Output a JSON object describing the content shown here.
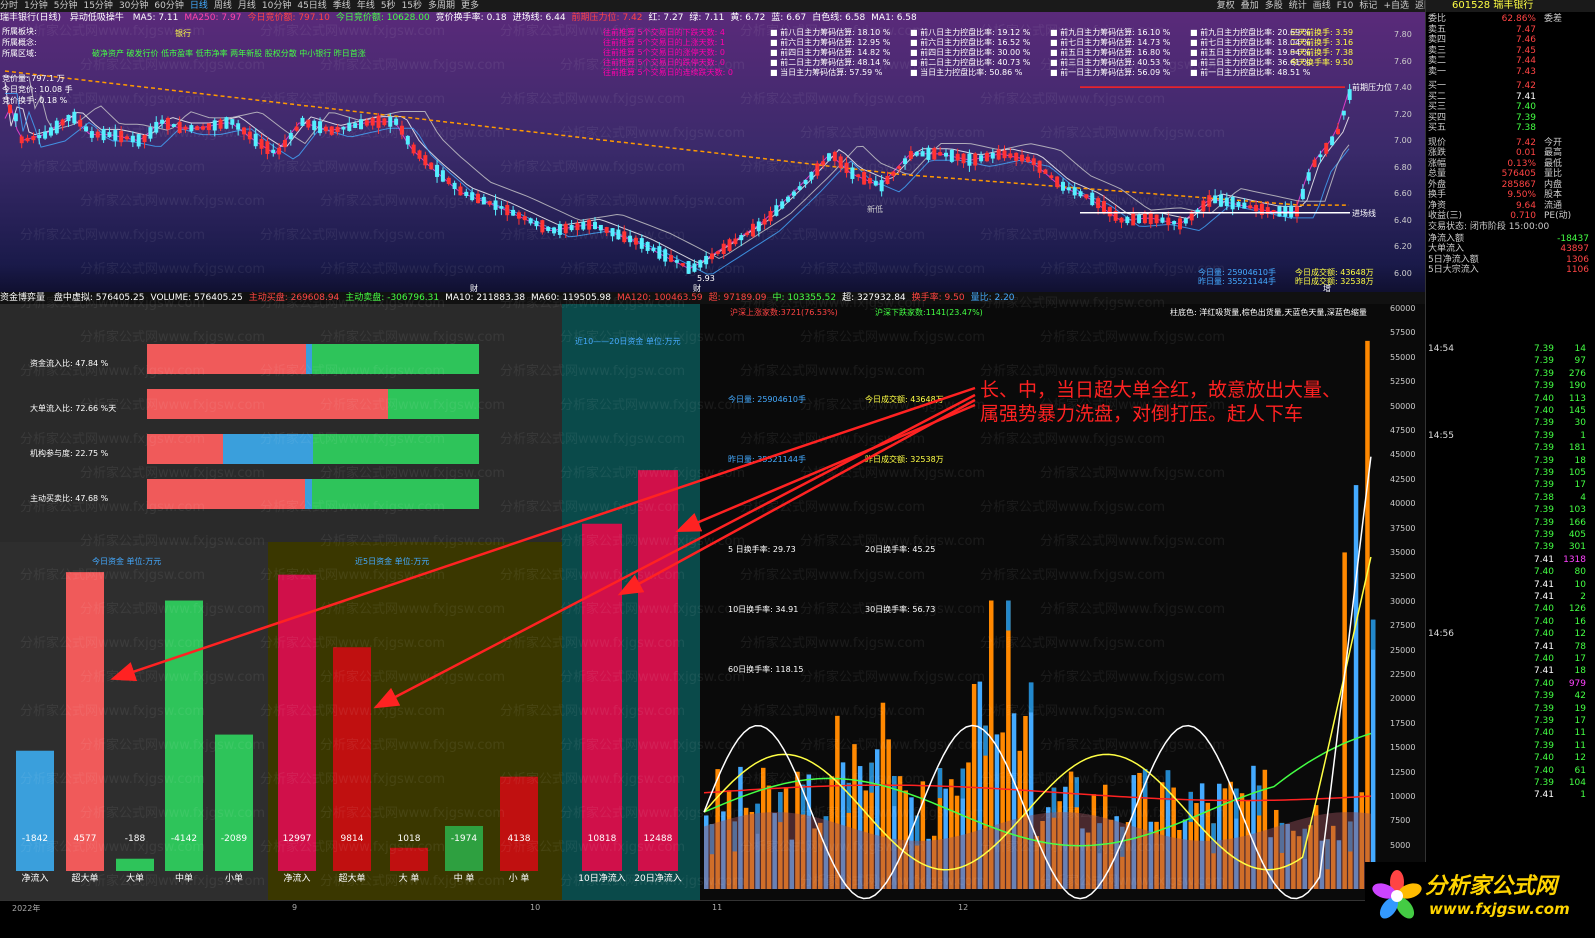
{
  "toolbar": {
    "left_items": [
      "分时",
      "1分钟",
      "5分钟",
      "15分钟",
      "30分钟",
      "60分钟",
      "日线",
      "周线",
      "月线",
      "10分钟",
      "45日线",
      "季线",
      "年线",
      "5秒",
      "15秒",
      "多周期",
      "更多"
    ],
    "active_item": "日线",
    "right_items": [
      "复权",
      "叠加",
      "多股",
      "统计",
      "画线",
      "F10",
      "标记",
      "+自选",
      "返回"
    ]
  },
  "kline_header": {
    "title": "瑞丰银行(日线)",
    "indicator": "异动低吸操牛",
    "items": [
      "MA5: 7.11",
      "MA250: 7.97",
      "今日竞价额: 797.10",
      "今日竞价额: 10628.00",
      "竞价换手率: 0.18",
      "进场线: 6.44",
      "前期压力位: 7.42",
      "红: 7.27",
      "绿: 7.11",
      "黄: 6.72",
      "蓝: 6.67",
      "白色线: 6.58",
      "MA1: 6.58"
    ]
  },
  "kline_info": {
    "left_labels": [
      "所属板块:",
      "所属概念:",
      "所属区域:"
    ],
    "sector": "银行",
    "concepts": "破净资产 破发行价 低市盈率 低市净率 两年新股 股权分散 中小银行 昨日首涨",
    "auction_labels": [
      "竞价量: 797.1 万",
      "今日竞价: 10.08 手",
      "竞价换手: 0.18 %"
    ],
    "magenta_lines": [
      "往前推算 5个交易日的下跌天数: 4",
      "往前推算 5个交易日的上涨天数: 1",
      "往前推算 5个交易日的涨停天数: 0",
      "往前推算 5个交易日的跌停天数: 0",
      "往前推算 5个交易日的连续跌天数: 0"
    ],
    "chip_columns": [
      [
        "前八日主力筹码估算: 18.10 %",
        "前六日主力筹码估算: 12.95 %",
        "前四日主力筹码估算: 14.82 %",
        "前二日主力筹码估算: 48.14 %",
        "当日主力筹码估算: 57.59 %"
      ],
      [
        "前八日主力控盘比率: 19.12 %",
        "前六日主力控盘比率: 16.52 %",
        "前四日主力控盘比率: 30.00 %",
        "前二日主力控盘比率: 40.73 %",
        "当日主力控盘比率: 50.86 %"
      ],
      [
        "前九日主力筹码估算: 16.10 %",
        "前七日主力筹码估算: 14.73 %",
        "前五日主力筹码估算: 16.80 %",
        "前三日主力筹码估算: 40.53 %",
        "前一日主力筹码估算: 56.09 %"
      ],
      [
        "前九日主力控盘比率: 20.69 %",
        "前七日主力控盘比率: 18.04 %",
        "前五日主力控盘比率: 19.84 %",
        "前三日主力控盘比率: 36.61 %",
        "前一日主力控盘比率: 48.51 %"
      ]
    ],
    "turnover_lines": [
      "三天前换手: 3.59",
      "二天前换手: 3.16",
      "一天前换手: 7.38",
      "今天换手率: 9.50"
    ],
    "annotations": {
      "resistance": "前期压力位",
      "entry": "进场线",
      "new_low": "新低",
      "price_low": "5.93",
      "marker_cai": "财",
      "marker_zeng": "增"
    },
    "volume_today": "今日量: 25904610手",
    "volume_yesterday": "昨日量: 35521144手",
    "amount_today": "今日成交额: 43648万",
    "amount_yesterday": "昨日成交额: 32538万",
    "y_ticks": [
      "7.80",
      "7.60",
      "7.40",
      "7.20",
      "7.00",
      "6.80",
      "6.60",
      "6.40",
      "6.20",
      "6.00"
    ]
  },
  "right_panel": {
    "code_name": "601528 瑞丰银行",
    "weibi": {
      "k": "委比",
      "v": "62.86%",
      "x": "委差"
    },
    "asks": [
      {
        "k": "卖五",
        "v": "7.47"
      },
      {
        "k": "卖四",
        "v": "7.46"
      },
      {
        "k": "卖三",
        "v": "7.45"
      },
      {
        "k": "卖二",
        "v": "7.44"
      },
      {
        "k": "卖一",
        "v": "7.43"
      }
    ],
    "bids": [
      {
        "k": "买一",
        "v": "7.42"
      },
      {
        "k": "买二",
        "v": "7.41"
      },
      {
        "k": "买三",
        "v": "7.40"
      },
      {
        "k": "买四",
        "v": "7.39"
      },
      {
        "k": "买五",
        "v": "7.38"
      }
    ],
    "stats": [
      {
        "k": "现价",
        "v": "7.42",
        "x": "今开"
      },
      {
        "k": "涨跌",
        "v": "0.01",
        "x": "最高"
      },
      {
        "k": "涨幅",
        "v": "0.13%",
        "x": "最低"
      },
      {
        "k": "总量",
        "v": "576405",
        "x": "量比"
      },
      {
        "k": "外盘",
        "v": "285867",
        "x": "内盘"
      },
      {
        "k": "换手",
        "v": "9.50%",
        "x": "股本"
      },
      {
        "k": "净资",
        "v": "9.64",
        "x": "流通"
      },
      {
        "k": "收益(三)",
        "v": "0.710",
        "x": "PE(动)"
      }
    ],
    "trade_status": "交易状态: 闭市阶段 15:00:00",
    "flows": [
      {
        "k": "净流入额",
        "v": "-18437"
      },
      {
        "k": "大单流入",
        "v": "43897"
      },
      {
        "k": "5日净流入额",
        "v": "1306"
      },
      {
        "k": "5日大宗流入",
        "v": "1106"
      }
    ],
    "ticks": [
      {
        "t": "14:54",
        "p": "7.39",
        "q": "14"
      },
      {
        "t": "",
        "p": "7.39",
        "q": "97"
      },
      {
        "t": "",
        "p": "7.39",
        "q": "276"
      },
      {
        "t": "",
        "p": "7.39",
        "q": "190"
      },
      {
        "t": "",
        "p": "7.40",
        "q": "113"
      },
      {
        "t": "",
        "p": "7.40",
        "q": "145"
      },
      {
        "t": "",
        "p": "7.39",
        "q": "30"
      },
      {
        "t": "14:55",
        "p": "7.39",
        "q": "1"
      },
      {
        "t": "",
        "p": "7.39",
        "q": "181"
      },
      {
        "t": "",
        "p": "7.39",
        "q": "18"
      },
      {
        "t": "",
        "p": "7.39",
        "q": "105"
      },
      {
        "t": "",
        "p": "7.39",
        "q": "17"
      },
      {
        "t": "",
        "p": "7.38",
        "q": "4"
      },
      {
        "t": "",
        "p": "7.39",
        "q": "103"
      },
      {
        "t": "",
        "p": "7.39",
        "q": "166"
      },
      {
        "t": "",
        "p": "7.39",
        "q": "405"
      },
      {
        "t": "",
        "p": "7.39",
        "q": "301"
      },
      {
        "t": "",
        "p": "7.41",
        "q": "1318"
      },
      {
        "t": "",
        "p": "7.40",
        "q": "80"
      },
      {
        "t": "",
        "p": "7.41",
        "q": "10"
      },
      {
        "t": "",
        "p": "7.41",
        "q": "2"
      },
      {
        "t": "",
        "p": "7.40",
        "q": "126"
      },
      {
        "t": "",
        "p": "7.40",
        "q": "16"
      },
      {
        "t": "14:56",
        "p": "7.40",
        "q": "12"
      },
      {
        "t": "",
        "p": "7.41",
        "q": "78"
      },
      {
        "t": "",
        "p": "7.40",
        "q": "17"
      },
      {
        "t": "",
        "p": "7.41",
        "q": "18"
      },
      {
        "t": "",
        "p": "7.40",
        "q": "979"
      },
      {
        "t": "",
        "p": "7.39",
        "q": "42"
      },
      {
        "t": "",
        "p": "7.39",
        "q": "19"
      },
      {
        "t": "",
        "p": "7.39",
        "q": "17"
      },
      {
        "t": "",
        "p": "7.40",
        "q": "11"
      },
      {
        "t": "",
        "p": "7.39",
        "q": "11"
      },
      {
        "t": "",
        "p": "7.40",
        "q": "12"
      },
      {
        "t": "",
        "p": "7.40",
        "q": "61"
      },
      {
        "t": "",
        "p": "7.39",
        "q": "104"
      },
      {
        "t": "",
        "p": "7.41",
        "q": "1"
      }
    ]
  },
  "bottom_header": {
    "title": "资金博弈量",
    "items": [
      "盘中虚拟: 576405.25",
      "VOLUME: 576405.25",
      "主动买盘: 269608.94",
      "主动卖盘: -306796.31",
      "MA10: 211883.38",
      "MA60: 119505.98",
      "MA120: 100463.59",
      "超: 97189.09",
      "中: 103355.52",
      "超: 327932.84",
      "换手率: 9.50",
      "量比: 2.20"
    ]
  },
  "ratios": [
    {
      "label": "资金流入比: 47.84 %",
      "red": 0.478,
      "blue": 0.02
    },
    {
      "label": "大单流入比: 72.66 %天",
      "red": 0.726,
      "blue": 0
    },
    {
      "label": "机构参与度: 22.75 %",
      "red": 0.23,
      "blue": 0.27
    },
    {
      "label": "主动买卖比: 47.68 %",
      "red": 0.477,
      "blue": 0.02
    }
  ],
  "panels": {
    "today_title": "今日资金  单位:万元",
    "five_title": "近5日资金  单位:万元",
    "ten_twenty_title": "近10——20日资金  单位:万元",
    "date_axis": [
      "2022年",
      "9",
      "10",
      "11",
      "12"
    ]
  },
  "chart_data": [
    {
      "type": "bar",
      "title": "今日资金  单位:万元",
      "categories": [
        "净流入",
        "超大单",
        "大单",
        "中单",
        "小单"
      ],
      "values": [
        -1842,
        4577,
        -188,
        -4142,
        -2089
      ]
    },
    {
      "type": "bar",
      "title": "近5日资金  单位:万元",
      "categories": [
        "净流入",
        "超大单",
        "大 单",
        "中 单",
        "小 单"
      ],
      "values": [
        12997,
        9814,
        1018,
        -1974,
        4138
      ]
    },
    {
      "type": "bar",
      "title": "近10——20日资金  单位:万元",
      "categories": [
        "10日净流入",
        "20日净流入"
      ],
      "values": [
        10818,
        12488
      ]
    }
  ],
  "volume_panel": {
    "legend_top": [
      "沪深上涨家数:3721(76.53%)",
      "沪深下跌家数:1141(23.47%)"
    ],
    "legend_right": "柱底色: 洋红吸货量,棕色出货量,天蓝色天量,深蓝色缩量",
    "stats": [
      "今日量: 25904610手",
      "今日成交额: 43648万",
      "昨日量: 35521144手",
      "昨日成交额: 32538万",
      "5 日换手率: 29.73",
      "20日换手率: 45.25",
      "10日换手率: 34.91",
      "30日换手率: 56.73",
      "60日换手率: 118.15"
    ],
    "y_ticks": [
      "60000",
      "57500",
      "55000",
      "52500",
      "50000",
      "47500",
      "45000",
      "42500",
      "40000",
      "37500",
      "35000",
      "32500",
      "30000",
      "27500",
      "25000",
      "22500",
      "20000",
      "17500",
      "15000",
      "12500",
      "10000",
      "7500",
      "5000"
    ]
  },
  "annotation_text": [
    "长、中，当日超大单全红，故意放出大量、",
    "属强势暴力洗盘，对倒打压。赶人下车"
  ],
  "watermark": [
    "分析家公式网www.fxjgsw.com"
  ],
  "logo": {
    "title": "分析家公式网",
    "url": "www.fxjgsw.com"
  },
  "colors": {
    "red": "#f05a5a",
    "green": "#2ec45a",
    "blue": "#3a9fdc",
    "crimson": "#d0104a",
    "darkred": "#c01010"
  }
}
